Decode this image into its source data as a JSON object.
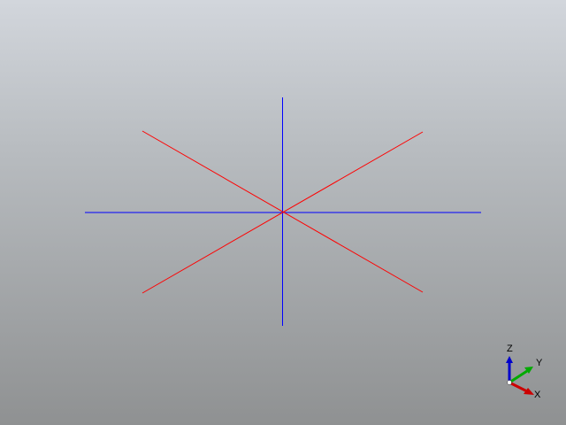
{
  "viewport": {
    "background_top": "#d2d6dc",
    "background_bottom": "#8f9192"
  },
  "scene": {
    "lines": [
      {
        "name": "horizontal-line",
        "color": "#0000ff"
      },
      {
        "name": "vertical-line",
        "color": "#0000ff"
      },
      {
        "name": "diagonal-line-rising",
        "color": "#ff0000"
      },
      {
        "name": "diagonal-line-falling",
        "color": "#ff0000"
      }
    ]
  },
  "axis_triad": {
    "z_label": "Z",
    "y_label": "Y",
    "x_label": "X",
    "z_color": "#0000cc",
    "y_color": "#00aa00",
    "x_color": "#cc0000"
  }
}
